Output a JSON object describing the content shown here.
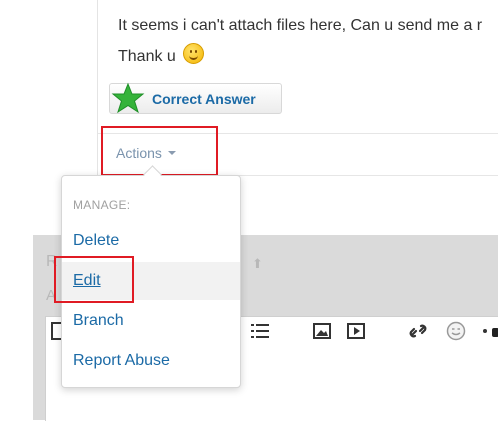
{
  "post": {
    "message_line1": "It seems i can't attach files here, Can u send me a r",
    "message_line2": "Thank u",
    "correct_answer_label": "Correct Answer"
  },
  "actions": {
    "label": "Actions"
  },
  "dropdown": {
    "header": "MANAGE:",
    "items": [
      "Delete",
      "Edit",
      "Branch",
      "Report Abuse"
    ],
    "hovered": "Edit"
  },
  "editor": {
    "ghost_title": "R",
    "ghost_label": "A"
  },
  "colors": {
    "link": "#1b6aa6",
    "highlight_box": "#e01b24",
    "star": "#35b33a"
  }
}
